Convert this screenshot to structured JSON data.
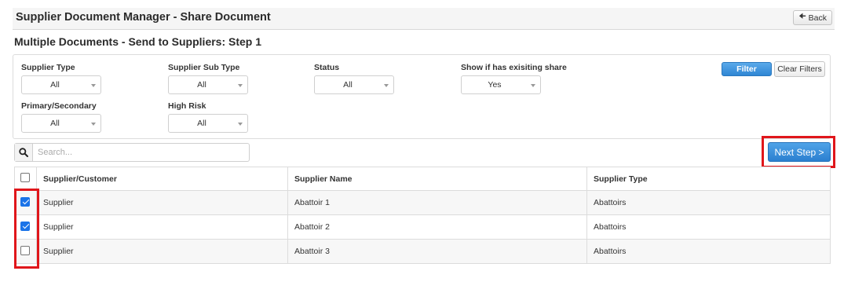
{
  "header": {
    "title": "Supplier Document Manager - Share Document",
    "back_label": "Back"
  },
  "page": {
    "step_title": "Multiple Documents - Send to Suppliers: Step 1"
  },
  "filters": {
    "supplier_type": {
      "label": "Supplier Type",
      "value": "All"
    },
    "supplier_sub_type": {
      "label": "Supplier Sub Type",
      "value": "All"
    },
    "status": {
      "label": "Status",
      "value": "All"
    },
    "show_existing_share": {
      "label": "Show if has exisiting share",
      "value": "Yes"
    },
    "primary_secondary": {
      "label": "Primary/Secondary",
      "value": "All"
    },
    "high_risk": {
      "label": "High Risk",
      "value": "All"
    },
    "filter_label": "Filter",
    "clear_label": "Clear Filters"
  },
  "search": {
    "placeholder": "Search...",
    "value": ""
  },
  "next_step_label": "Next Step >",
  "table": {
    "columns": [
      "Supplier/Customer",
      "Supplier Name",
      "Supplier Type"
    ],
    "rows": [
      {
        "checked": true,
        "supplier_customer": "Supplier",
        "supplier_name": "Abattoir 1",
        "supplier_type": "Abattoirs"
      },
      {
        "checked": true,
        "supplier_customer": "Supplier",
        "supplier_name": "Abattoir 2",
        "supplier_type": "Abattoirs"
      },
      {
        "checked": false,
        "supplier_customer": "Supplier",
        "supplier_name": "Abattoir 3",
        "supplier_type": "Abattoirs"
      }
    ]
  },
  "colors": {
    "primary_button": "#2f86d4",
    "highlight": "#e0161b",
    "checkbox_checked": "#1a73e8"
  },
  "icons": {
    "back": "arrow-left-icon",
    "search": "search-icon",
    "select_caret": "caret-down-icon"
  }
}
